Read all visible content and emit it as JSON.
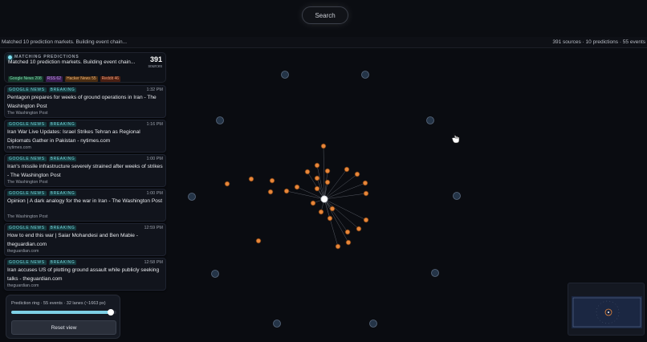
{
  "search": {
    "label": "Search"
  },
  "status": {
    "message": "Matched 10 prediction markets. Building event chain...",
    "counts": "391 sources · 10 predictions · 55 events"
  },
  "summary": {
    "heading": "MATCHING PREDICTIONS",
    "text": "Matched 10 prediction markets. Building event chain...",
    "count": "391",
    "count_label": "sources",
    "chips": [
      "Google News 208",
      "RSS 62",
      "Hacker News 55",
      "Reddit 46"
    ]
  },
  "feed": [
    {
      "source_tag": "GOOGLE NEWS",
      "badge": "BREAKING",
      "time": "1:32 PM",
      "headline": "Pentagon prepares for weeks of ground operations in Iran - The Washington Post",
      "publisher": "The Washington Post"
    },
    {
      "source_tag": "GOOGLE NEWS",
      "badge": "BREAKING",
      "time": "1:16 PM",
      "headline": "Iran War Live Updates: Israel Strikes Tehran as Regional Diplomats Gather in Pakistan - nytimes.com",
      "publisher": "nytimes.com"
    },
    {
      "source_tag": "GOOGLE NEWS",
      "badge": "BREAKING",
      "time": "1:00 PM",
      "headline": "Iran's missile infrastructure severely strained after weeks of strikes - The Washington Post",
      "publisher": "The Washington Post"
    },
    {
      "source_tag": "GOOGLE NEWS",
      "badge": "BREAKING",
      "time": "1:00 PM",
      "headline": "Opinion | A dark analogy for the war in Iran - The Washington Post",
      "publisher": "The Washington Post"
    },
    {
      "source_tag": "GOOGLE NEWS",
      "badge": "BREAKING",
      "time": "12:59 PM",
      "headline": "How to end this war | Saiar Mohandesi and Ben Mabie - theguardian.com",
      "publisher": "theguardian.com"
    },
    {
      "source_tag": "GOOGLE NEWS",
      "badge": "BREAKING",
      "time": "12:58 PM",
      "headline": "Iran accuses US of plotting ground assault while publicly seeking talks - theguardian.com",
      "publisher": "theguardian.com"
    }
  ],
  "controls": {
    "label": "Prediction ring · 55 events · 32 lanes (~1663 px)",
    "slider_fraction": 0.95,
    "reset_label": "Reset view"
  },
  "colors": {
    "event_node": "#e8873a",
    "prediction_node": "#243447",
    "center_node": "#ffffff"
  }
}
